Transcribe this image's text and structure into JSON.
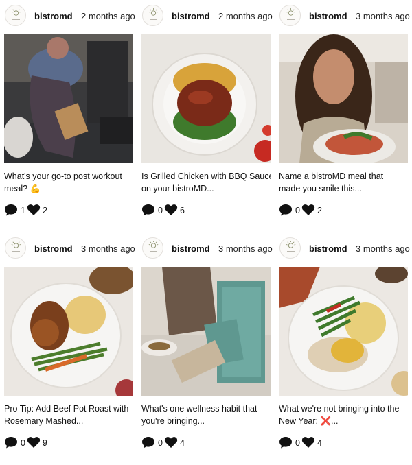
{
  "posts": [
    {
      "username": "bistromd",
      "time": "2 months ago",
      "caption_line1": "What's your go-to post workout",
      "caption_line2": "meal? 💪",
      "comments": "1",
      "likes": "2",
      "image": "woman-gym-meal-box"
    },
    {
      "username": "bistromd",
      "time": "2 months ago",
      "caption_line1": "Is Grilled Chicken with BBQ Sauce",
      "caption_line2": "on your bistroMD...",
      "comments": "0",
      "likes": "6",
      "image": "bbq-chicken-plate"
    },
    {
      "username": "bistromd",
      "time": "3 months ago",
      "caption_line1": "Name a bistroMD meal that",
      "caption_line2": "made you smile this...",
      "comments": "0",
      "likes": "2",
      "image": "woman-smiling-meal"
    },
    {
      "username": "bistromd",
      "time": "3 months ago",
      "caption_line1": "Pro Tip: Add Beef Pot Roast with",
      "caption_line2": "Rosemary Mashed...",
      "comments": "0",
      "likes": "9",
      "image": "pot-roast-plate"
    },
    {
      "username": "bistromd",
      "time": "3 months ago",
      "caption_line1": "What's one wellness habit that",
      "caption_line2": "you're bringing...",
      "comments": "0",
      "likes": "4",
      "image": "meal-boxes-table"
    },
    {
      "username": "bistromd",
      "time": "3 months ago",
      "caption_line1": "What we're not bringing into the",
      "caption_line2": "New Year: ❌...",
      "comments": "0",
      "likes": "4",
      "image": "chicken-mash-plate"
    }
  ]
}
